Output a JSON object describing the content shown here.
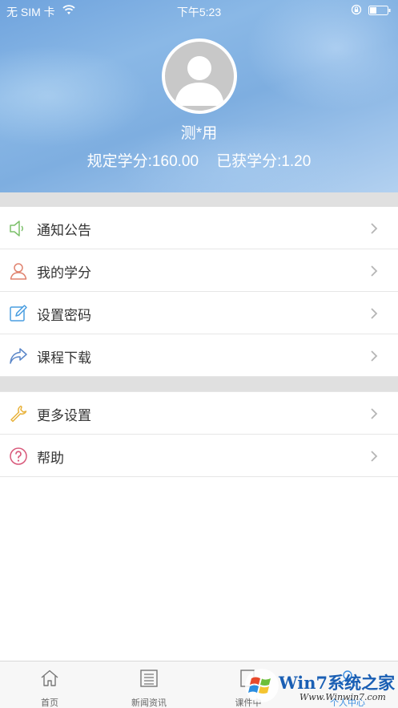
{
  "status_bar": {
    "carrier": "无 SIM 卡",
    "time": "下午5:23"
  },
  "profile": {
    "username": "测*用",
    "required_credits_label": "规定学分:160.00",
    "earned_credits_label": "已获学分:1.20"
  },
  "menu_group_1": [
    {
      "label": "通知公告",
      "icon": "speaker-icon",
      "color": "#7cc06a"
    },
    {
      "label": "我的学分",
      "icon": "person-icon",
      "color": "#e0826e"
    },
    {
      "label": "设置密码",
      "icon": "edit-icon",
      "color": "#4a9ee0"
    },
    {
      "label": "课程下载",
      "icon": "share-arrow-icon",
      "color": "#5a86c8"
    }
  ],
  "menu_group_2": [
    {
      "label": "更多设置",
      "icon": "wrench-icon",
      "color": "#e8b23a"
    },
    {
      "label": "帮助",
      "icon": "help-icon",
      "color": "#d8587a"
    }
  ],
  "tabs": [
    {
      "label": "首页",
      "icon": "home-icon",
      "active": false
    },
    {
      "label": "新闻资讯",
      "icon": "news-icon",
      "active": false
    },
    {
      "label": "课件中",
      "icon": "courseware-icon",
      "active": false
    },
    {
      "label": "个人中心",
      "icon": "user-center-icon",
      "active": true
    }
  ],
  "watermark": {
    "text": "Win7系统之家",
    "url": "Www.Winwin7.com"
  },
  "colors": {
    "accent": "#3a8de0",
    "separator": "#e0e0e0"
  }
}
